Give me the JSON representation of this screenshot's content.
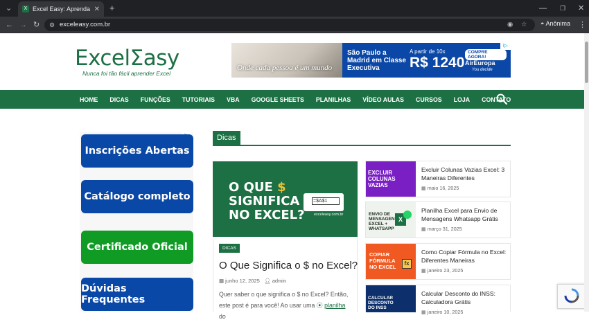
{
  "browser": {
    "tab_title": "Excel Easy: Aprenda Excel de m",
    "url": "exceleasy.com.br",
    "profile": "Anônima"
  },
  "site": {
    "logo_text": "ExcelΣasy",
    "tagline": "Nunca foi tão fácil aprender Excel",
    "nav": [
      "HOME",
      "DICAS",
      "FUNÇÕES",
      "TUTORIAIS",
      "VBA",
      "GOOGLE SHEETS",
      "PLANILHAS",
      "VÍDEO AULAS",
      "CURSOS",
      "LOJA",
      "CONTATO"
    ]
  },
  "ad": {
    "slogan": "Onde cada pessoa é um mundo",
    "route": "São Paulo a Madrid em Classe Executiva",
    "from": "A partir de 10x",
    "price": "R$ 1240",
    "cta": "COMPRE AGORA!",
    "airline": "AirEuropa",
    "decide": "You decide"
  },
  "sidebar": [
    "Inscrições Abertas",
    "Catálogo completo",
    "Certificado Oficial",
    "Dúvidas Frequentes"
  ],
  "section_title": "Dicas",
  "featured": {
    "image_line1": "O QUE",
    "image_dollar": "$",
    "image_line2": "SIGNIFICA",
    "image_line3": "NO EXCEL?",
    "image_cell": "=$A$1",
    "image_domain": "exceleasy.com.br",
    "category": "DICAS",
    "title": "O Que Significa o $ no Excel?",
    "date": "junho 12, 2025",
    "author": "admin",
    "excerpt_a": "Quer saber o que significa o $ no Excel? Então, este post é para você! Ao usar uma",
    "excerpt_link": "planilha",
    "excerpt_b": "do"
  },
  "posts": [
    {
      "thumb": "EXCLUIR COLUNAS VAZIAS",
      "title": "Excluir Colunas Vazias Excel: 3 Maneiras Diferentes",
      "date": "maio 16, 2025"
    },
    {
      "thumb": "ENVIO DE MENSAGENS EXCEL + WHATSAPP",
      "title": "Planilha Excel para Envio de Mensagens Whatsapp Grátis",
      "date": "março 31, 2025"
    },
    {
      "thumb": "COPIAR FÓRMULA NO EXCEL",
      "title": "Como Copiar Fórmula no Excel: Diferentes Maneiras",
      "date": "janeiro 23, 2025"
    },
    {
      "thumb": "CALCULAR DESCONTO DO INSS",
      "title": "Calcular Desconto do INSS: Calculadora Grátis",
      "date": "janeiro 10, 2025"
    }
  ],
  "colors": {
    "brand": "#1d7044",
    "sidebar_blue": "#0a48a8",
    "sidebar_green": "#0f9b24"
  }
}
